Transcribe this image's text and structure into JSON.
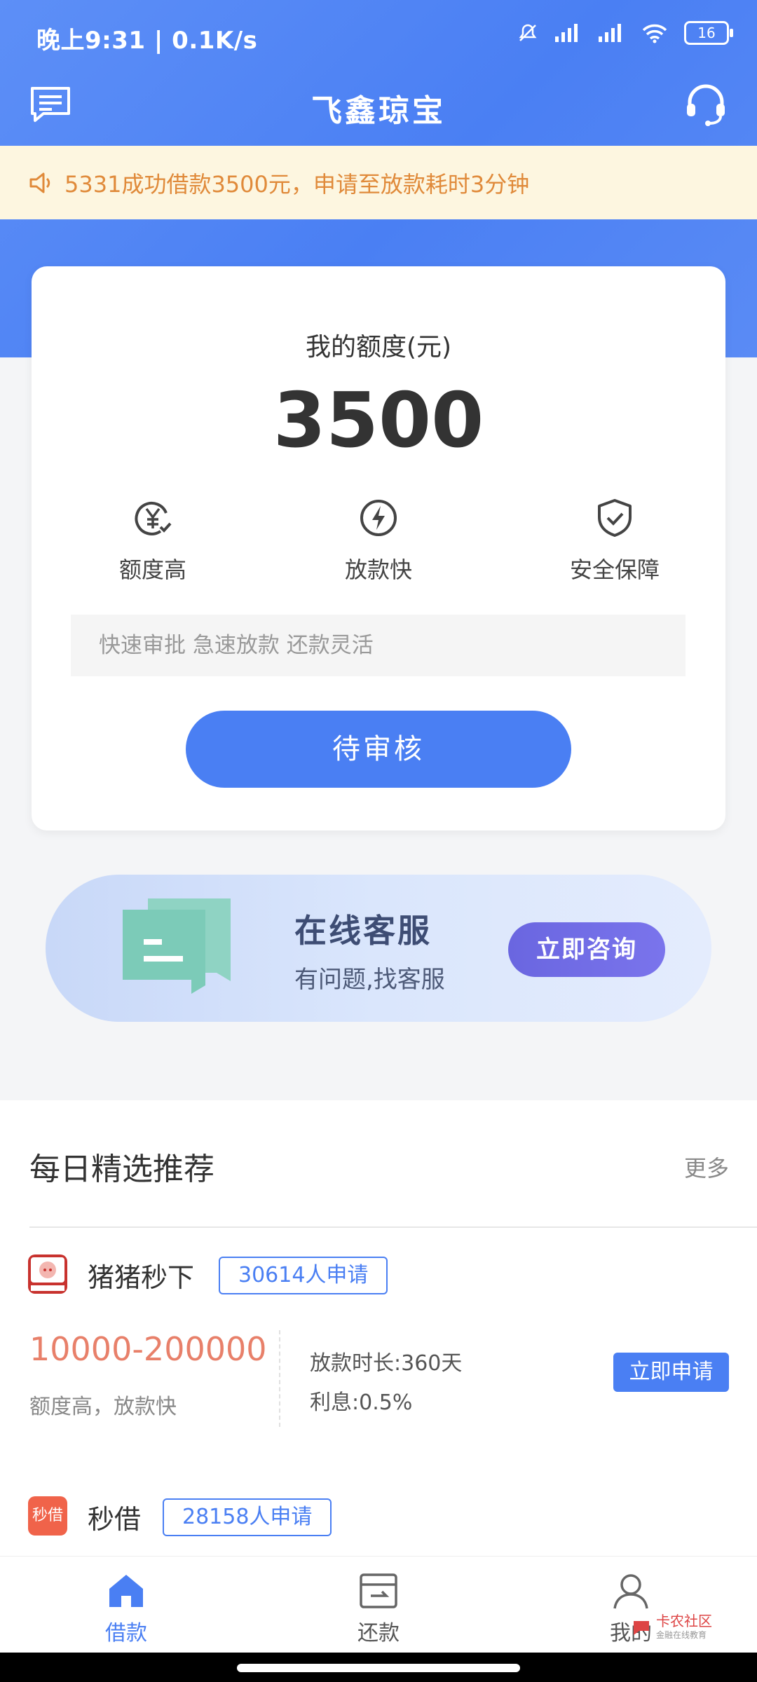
{
  "status_bar": {
    "time_network": "晚上9:31 | 0.1K/s",
    "battery": "16"
  },
  "header": {
    "title": "飞鑫琼宝"
  },
  "notice": {
    "text": "5331成功借款3500元，申请至放款耗时3分钟"
  },
  "quota_card": {
    "label": "我的额度(元)",
    "value": "3500",
    "features": [
      {
        "label": "额度高",
        "icon": "yuan-check-icon"
      },
      {
        "label": "放款快",
        "icon": "lightning-icon"
      },
      {
        "label": "安全保障",
        "icon": "shield-check-icon"
      }
    ],
    "tagline": "快速审批 急速放款 还款灵活",
    "button": "待审核"
  },
  "customer_service": {
    "title": "在线客服",
    "subtitle": "有问题,找客服",
    "button": "立即咨询"
  },
  "recommend": {
    "title": "每日精选推荐",
    "more": "更多",
    "products": [
      {
        "name": "猪猪秒下",
        "logo_text": "猪猪秒下",
        "applicants": "30614人申请",
        "range": "10000-200000",
        "range_sub": "额度高，放款快",
        "duration": "放款时长:360天",
        "interest": "利息:0.5%",
        "apply": "立即申请"
      },
      {
        "name": "秒借",
        "logo_text": "秒借",
        "applicants": "28158人申请"
      }
    ]
  },
  "tabbar": {
    "items": [
      {
        "label": "借款",
        "active": true
      },
      {
        "label": "还款",
        "active": false
      },
      {
        "label": "我的",
        "active": false
      }
    ]
  },
  "watermark": {
    "text": "卡农社区",
    "sub": "金融在线教育"
  },
  "colors": {
    "primary": "#4a7ff3",
    "accent_orange": "#e8806a",
    "notice_bg": "#fdf6e0"
  }
}
